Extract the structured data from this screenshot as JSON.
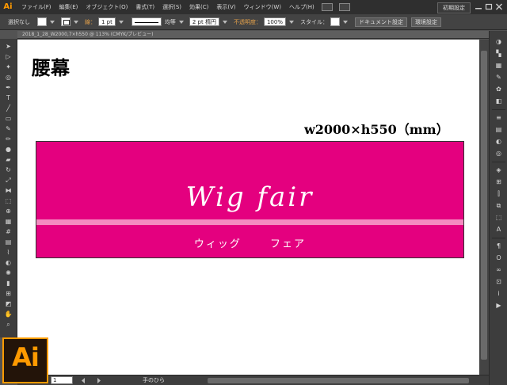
{
  "app": {
    "logo": "Ai",
    "accent": "#ff9a00",
    "menu": [
      "ファイル(F)",
      "編集(E)",
      "オブジェクト(O)",
      "書式(T)",
      "選択(S)",
      "効果(C)",
      "表示(V)",
      "ウィンドウ(W)",
      "ヘルプ(H)"
    ],
    "workspace": "初期設定"
  },
  "control": {
    "selection": "選択なし",
    "stroke_label": "線：",
    "stroke_weight": "1 pt",
    "profile": "均等",
    "brush": "2 pt 楕円",
    "opacity_label": "不透明度：",
    "opacity": "100%",
    "style_label": "スタイル：",
    "doc_settings": "ドキュメント設定",
    "prefs": "環境設定"
  },
  "document": {
    "tab": "2018_1_28_W2000,7×h550 @ 113% (CMYK/プレビュー)",
    "tool_status": "手のひら",
    "zoom": "1"
  },
  "artwork": {
    "title": "腰幕",
    "dimensions": "w2000×h550（mm）",
    "banner_color": "#e4007f",
    "stripe_color": "#f48bc0",
    "script_text": "Wig fair",
    "kana_text": "ウィッグ フェア"
  },
  "tools": [
    "selection-icon",
    "direct-selection-icon",
    "magic-wand-icon",
    "lasso-icon",
    "pen-icon",
    "type-icon",
    "line-icon",
    "rectangle-icon",
    "paintbrush-icon",
    "pencil-icon",
    "blob-brush-icon",
    "eraser-icon",
    "rotate-icon",
    "scale-icon",
    "width-icon",
    "free-transform-icon",
    "shape-builder-icon",
    "perspective-icon",
    "mesh-icon",
    "gradient-icon",
    "eyedropper-icon",
    "blend-icon",
    "symbol-sprayer-icon",
    "graph-icon",
    "artboard-icon",
    "slice-icon",
    "hand-icon",
    "zoom-icon"
  ],
  "panels": [
    "color-icon",
    "color-guide-icon",
    "swatches-icon",
    "brushes-icon",
    "symbols-icon",
    "graphic-styles-icon",
    "stroke-icon",
    "gradient-panel-icon",
    "transparency-icon",
    "appearance-icon",
    "layers-icon",
    "artboards-icon",
    "align-icon",
    "pathfinder-icon",
    "transform-icon",
    "character-icon",
    "paragraph-icon",
    "opentype-icon",
    "links-icon",
    "navigator-icon",
    "info-icon",
    "actions-icon"
  ]
}
